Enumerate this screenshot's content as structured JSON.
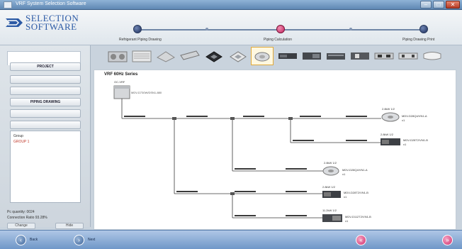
{
  "window": {
    "title": "VRF System Selection Software"
  },
  "logo": {
    "line1": "SELECTION",
    "line2": "SOFTWARE"
  },
  "steps": [
    {
      "label": "Refrigerant Piping Drawing"
    },
    {
      "label": "Piping Calculation"
    },
    {
      "label": "Piping Drawing Print"
    }
  ],
  "units": [
    "outdoor-unit",
    "heat-exchanger",
    "ceiling-cassette",
    "wall-duct",
    "cassette",
    "cassette-4way",
    "console",
    "duct-slim",
    "duct-high",
    "duct-medium",
    "wall-mounted-a",
    "wall-mounted-b",
    "wall-mounted-c",
    "wall-split"
  ],
  "left_panel": {
    "nav": [
      {
        "label": "PROJECT",
        "style": "bold"
      },
      {
        "label": "",
        "style": "faded"
      },
      {
        "label": "",
        "style": "faded"
      },
      {
        "label": "PIPING DRAWING",
        "style": "bold"
      },
      {
        "label": "",
        "style": "faded"
      },
      {
        "label": "",
        "style": "faded"
      }
    ],
    "group_box": {
      "header": "Group",
      "item": "GROUP 1"
    },
    "stats": [
      "Pc quantity: 0024",
      "Connection Ratio 93.28%"
    ],
    "buttons": [
      "Change",
      "Hide"
    ]
  },
  "diagram": {
    "title": "VRF 60Hz Series",
    "outdoor": {
      "name": "OC-VRF",
      "model": "MDV-D730W/DSN1-880"
    },
    "indoor_units": [
      {
        "capacity": "2.8kW 1/2",
        "model": "MDV-D28Q4/VN1-A",
        "qty": "x1"
      },
      {
        "capacity": "2.8kW 1/2",
        "model": "MDV-D28T2/VN1-B",
        "qty": "x1"
      },
      {
        "capacity": "2.8kW 1/2",
        "model": "MDV-D28Q4/VN1-A",
        "qty": "x1"
      },
      {
        "capacity": "2.8kW 1/2",
        "model": "MDV-D28T2/VN1-B",
        "qty": "x1"
      },
      {
        "capacity": "11.2kW 1/2",
        "model": "MDV-D112T2/VN1-B",
        "qty": "x1"
      }
    ]
  },
  "bottom_bar": {
    "left_labels": [
      "Back",
      "Next"
    ]
  },
  "colors": {
    "accent": "#c4245f",
    "pipe": "#3a3a3a",
    "titlebar": "#5f87b3"
  }
}
